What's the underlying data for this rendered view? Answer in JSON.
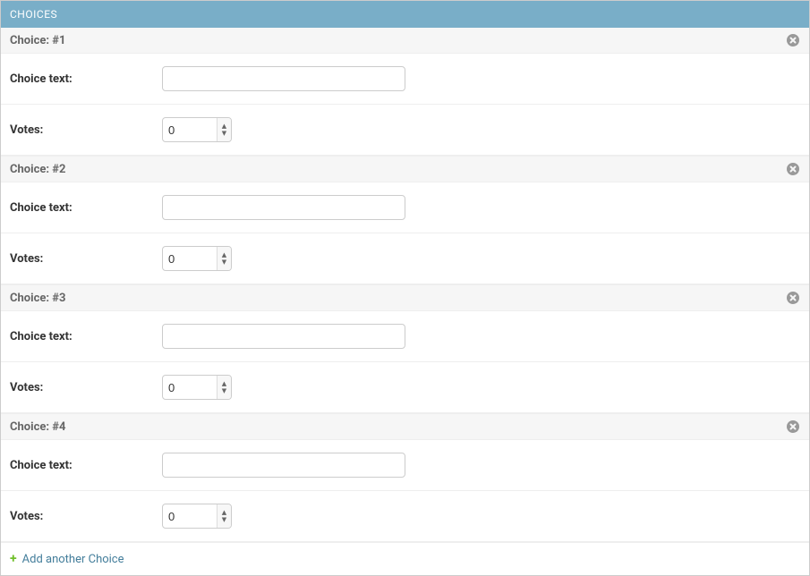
{
  "header": {
    "title": "CHOICES"
  },
  "labels": {
    "choice_text": "Choice text:",
    "votes": "Votes:"
  },
  "choices": [
    {
      "title": "Choice: #1",
      "choice_text": "",
      "votes": "0"
    },
    {
      "title": "Choice: #2",
      "choice_text": "",
      "votes": "0"
    },
    {
      "title": "Choice: #3",
      "choice_text": "",
      "votes": "0"
    },
    {
      "title": "Choice: #4",
      "choice_text": "",
      "votes": "0"
    }
  ],
  "add_another": "Add another Choice"
}
